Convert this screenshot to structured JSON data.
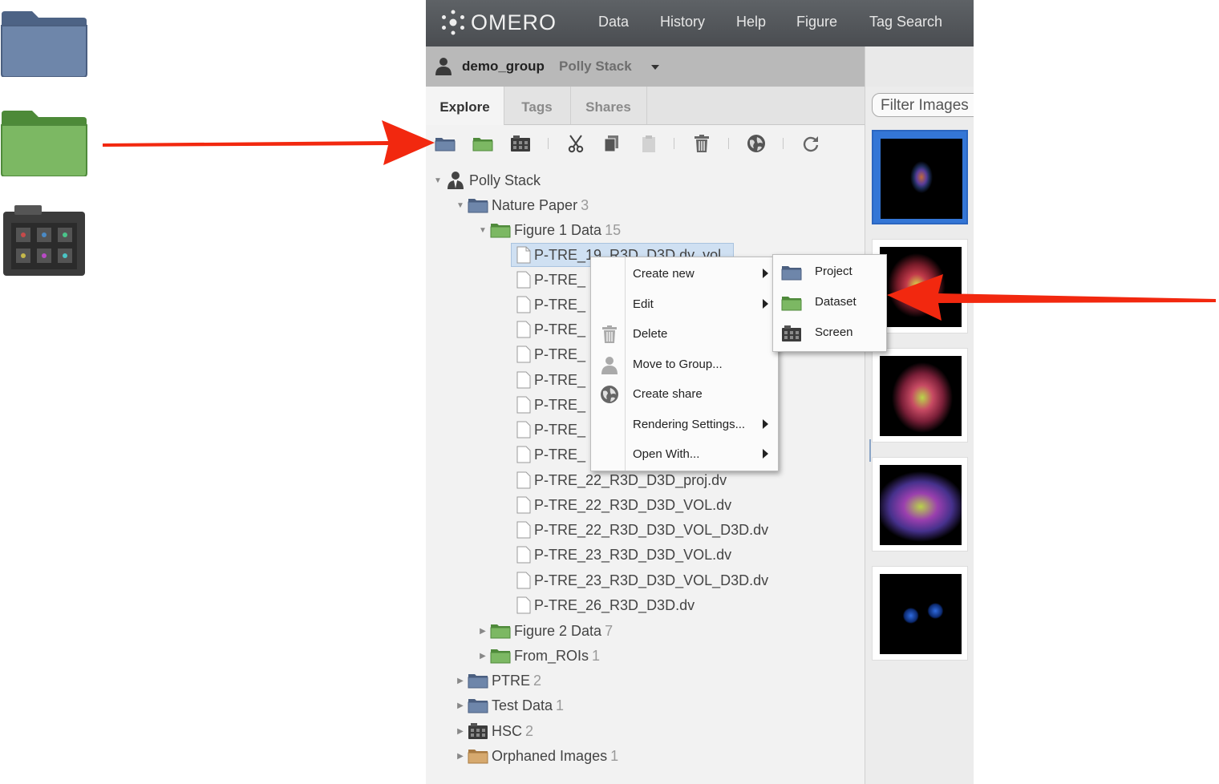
{
  "app": {
    "logo_text": "OMERO",
    "nav": [
      "Data",
      "History",
      "Help",
      "Figure",
      "Tag Search"
    ]
  },
  "group_bar": {
    "group": "demo_group",
    "user": "Polly Stack"
  },
  "tabs": [
    "Explore",
    "Tags",
    "Shares"
  ],
  "tree": {
    "root": "Polly Stack",
    "project": {
      "name": "Nature Paper",
      "count": "3"
    },
    "dataset": {
      "name": "Figure 1 Data",
      "count": "15"
    },
    "selected_image": "P-TRE_19_R3D_D3D.dv_vol",
    "truncated_image": "P-TRE_",
    "images": [
      "P-TRE_22_R3D_D3D_proj.dv",
      "P-TRE_22_R3D_D3D_VOL.dv",
      "P-TRE_22_R3D_D3D_VOL_D3D.dv",
      "P-TRE_23_R3D_D3D_VOL.dv",
      "P-TRE_23_R3D_D3D_VOL_D3D.dv",
      "P-TRE_26_R3D_D3D.dv"
    ],
    "other_datasets": [
      {
        "name": "Figure 2 Data",
        "count": "7"
      },
      {
        "name": "From_ROIs",
        "count": "1"
      }
    ],
    "other_items": [
      {
        "name": "PTRE",
        "count": "2",
        "kind": "project"
      },
      {
        "name": "Test Data",
        "count": "1",
        "kind": "project"
      },
      {
        "name": "HSC",
        "count": "2",
        "kind": "screen"
      },
      {
        "name": "Orphaned Images",
        "count": "1",
        "kind": "orphaned"
      }
    ]
  },
  "right_panel": {
    "filter_placeholder": "Filter Images"
  },
  "context_menu": {
    "items": [
      "Create new",
      "Edit",
      "Delete",
      "Move to Group...",
      "Create share",
      "Rendering Settings...",
      "Open With..."
    ],
    "submenu": [
      "Project",
      "Dataset",
      "Screen"
    ]
  },
  "colors": {
    "project_folder": "#5b7396",
    "dataset_folder": "#6fa553",
    "screen_icon": "#3a3a3a",
    "orphaned_folder": "#c99a5e",
    "arrow": "#f2280f",
    "selection": "#3476d6"
  },
  "icons": {
    "toolbar": [
      "project-folder-icon",
      "dataset-folder-icon",
      "screen-icon",
      "cut-icon",
      "copy-icon",
      "paste-icon",
      "delete-icon",
      "share-icon",
      "refresh-icon"
    ]
  }
}
